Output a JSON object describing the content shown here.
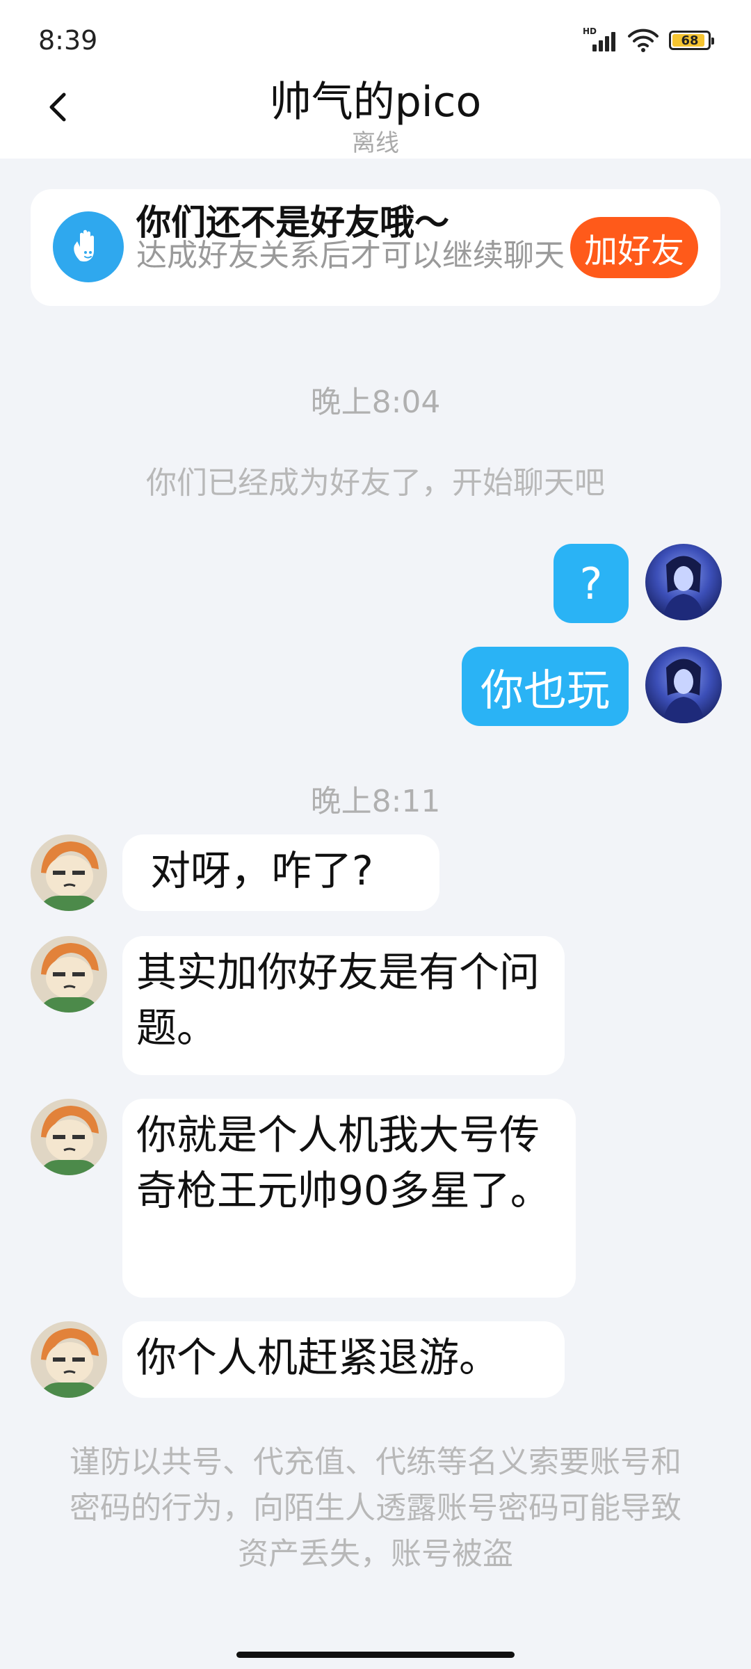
{
  "status_bar": {
    "time": "8:39",
    "battery": "68",
    "network": "HD"
  },
  "header": {
    "title": "帅气的pico",
    "status": "离线"
  },
  "notice": {
    "title": "你们还不是好友哦～",
    "description": "达成好友关系后才可以继续聊天",
    "button": "加好友",
    "icon": "wave-hand-icon"
  },
  "messages": {
    "timestamp_1": "晚上8:04",
    "system_1": "你们已经成为好友了，开始聊天吧",
    "me_1": "?",
    "me_2": "你也玩",
    "timestamp_2": "晚上8:11",
    "other_1": "对呀，咋了?",
    "other_2": "其实加你好友是有个问题。",
    "other_3": "你就是个人机我大号传奇枪王元帅90多星了。",
    "other_4": "你个人机赶紧退游。"
  },
  "warning": "谨防以共号、代充值、代练等名义索要账号和密码的行为，向陌生人透露账号密码可能导致资产丢失，账号被盗",
  "colors": {
    "accent": "#2ab3f5",
    "button": "#ff5a1a",
    "background": "#f2f4f8"
  }
}
